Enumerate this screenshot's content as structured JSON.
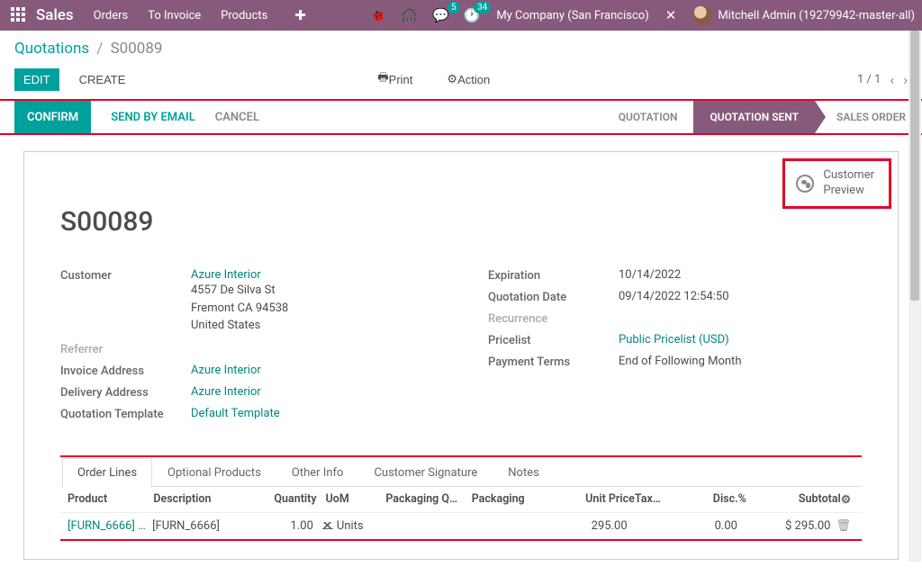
{
  "topbar": {
    "brand": "Sales",
    "nav": [
      "Orders",
      "To Invoice",
      "Products"
    ],
    "msg_badge": "5",
    "act_badge": "34",
    "company": "My Company (San Francisco)",
    "user": "Mitchell Admin (19279942-master-all)"
  },
  "breadcrumb": {
    "root": "Quotations",
    "leaf": "S00089"
  },
  "buttons": {
    "edit": "EDIT",
    "create": "CREATE",
    "print": "Print",
    "action": "Action"
  },
  "pager": "1 / 1",
  "statusbar": {
    "confirm": "CONFIRM",
    "send": "SEND BY EMAIL",
    "cancel": "CANCEL",
    "stages": [
      "QUOTATION",
      "QUOTATION SENT",
      "SALES ORDER"
    ]
  },
  "preview": {
    "line1": "Customer",
    "line2": "Preview"
  },
  "order": {
    "name": "S00089",
    "customer_label": "Customer",
    "customer": "Azure Interior",
    "addr1": "4557 De Silva St",
    "addr2": "Fremont CA 94538",
    "addr3": "United States",
    "referrer_label": "Referrer",
    "inv_label": "Invoice Address",
    "inv": "Azure Interior",
    "del_label": "Delivery Address",
    "del": "Azure Interior",
    "tmpl_label": "Quotation Template",
    "tmpl": "Default Template",
    "exp_label": "Expiration",
    "exp": "10/14/2022",
    "qd_label": "Quotation Date",
    "qd": "09/14/2022 12:54:50",
    "rec_label": "Recurrence",
    "pl_label": "Pricelist",
    "pl": "Public Pricelist (USD)",
    "pt_label": "Payment Terms",
    "pt": "End of Following Month"
  },
  "tabs": [
    "Order Lines",
    "Optional Products",
    "Other Info",
    "Customer Signature",
    "Notes"
  ],
  "cols": {
    "product": "Product",
    "desc": "Description",
    "qty": "Quantity",
    "uom": "UoM",
    "pq": "Packaging Q…",
    "pack": "Packaging",
    "up": "Unit Price",
    "tax": "Tax…",
    "disc": "Disc.%",
    "sub": "Subtotal"
  },
  "line": {
    "product": "[FURN_6666] …",
    "desc": "[FURN_6666]",
    "qty": "1.00",
    "uom": "Units",
    "up": "295.00",
    "disc": "0.00",
    "sub": "$ 295.00"
  }
}
